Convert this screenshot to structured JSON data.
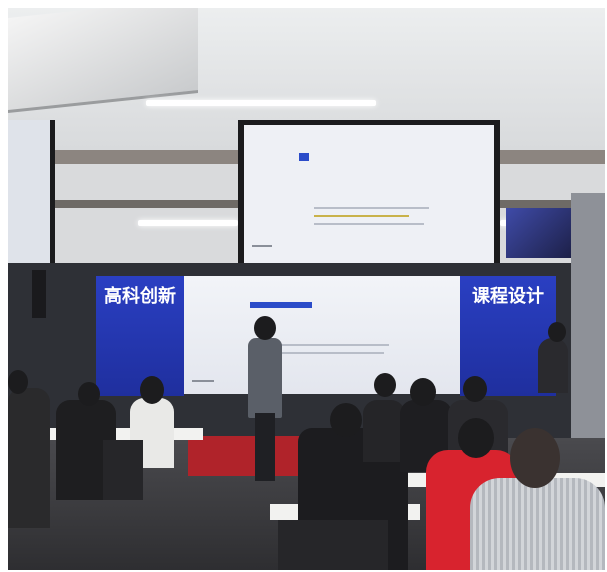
{
  "scene": {
    "left_banner_text": "高科创新",
    "right_banner_text": "课程设计"
  },
  "colors": {
    "banner_blue": "#2a3fc2",
    "stage_carpet": "#b0232a",
    "red_jacket": "#d8232e"
  }
}
